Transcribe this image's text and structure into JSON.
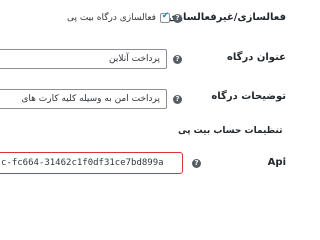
{
  "settings": {
    "enable": {
      "label": "فعالسازی/غیرفعالسازی",
      "checkbox_label": "فعالسازی درگاه بیت پی",
      "checked": true
    },
    "title": {
      "label": "عنوان درگاه",
      "value": "پرداخت آنلاین"
    },
    "description": {
      "label": "توضیحات درگاه",
      "value": "پرداخت امن به وسیله کلیه کارت های"
    },
    "account_heading": "تنظیمات حساب بیت پی",
    "api": {
      "label": "Api",
      "value": "c-fc664-31462c1f0df31ce7bd899a"
    }
  },
  "icons": {
    "help": "?"
  },
  "colors": {
    "error_border": "#d63638",
    "help_icon": "#555d66",
    "check": "#1e8cbe"
  }
}
